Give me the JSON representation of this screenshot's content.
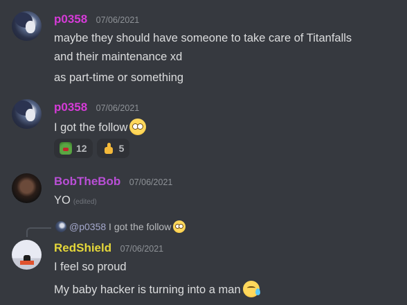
{
  "colors": {
    "background": "#36393f",
    "p0358": "#d63bd8",
    "bobthebob": "#b94fd6",
    "redshield": "#e5d73a"
  },
  "messages": [
    {
      "user": "p0358",
      "timestamp": "07/06/2021",
      "lines": [
        "maybe they should have someone to take care of Titanfalls",
        "and their maintenance xd",
        "as part-time or something"
      ]
    },
    {
      "user": "p0358",
      "timestamp": "07/06/2021",
      "lines": [
        "I got the follow"
      ],
      "emoji": "flushed-face-emoji",
      "reactions": [
        {
          "icon": "frog-emoji",
          "count": "12"
        },
        {
          "icon": "thumbs-up-emoji",
          "count": "5"
        }
      ]
    },
    {
      "user": "BobTheBob",
      "timestamp": "07/06/2021",
      "lines": [
        "YO"
      ],
      "edited": "(edited)"
    },
    {
      "reply": {
        "mention": "@p0358",
        "text": "I got the follow",
        "emoji": "flushed-face-emoji"
      },
      "user": "RedShield",
      "timestamp": "07/06/2021",
      "lines": [
        "I feel so proud",
        "My baby hacker is turning into a man"
      ],
      "emoji": "face-holding-back-tears-emoji"
    }
  ]
}
